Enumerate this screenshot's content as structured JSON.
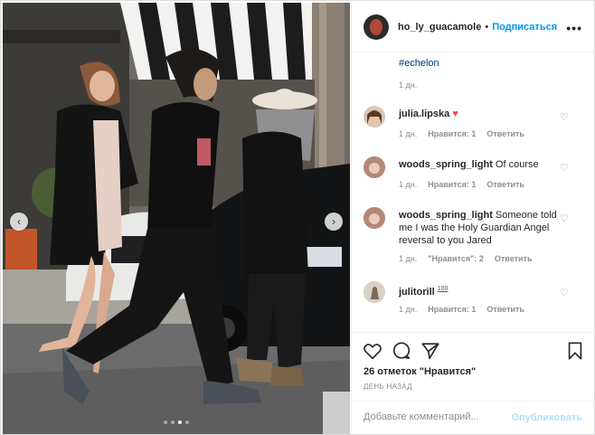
{
  "post": {
    "username": "ho_ly_guacamole",
    "separator": "•",
    "follow_label": "Подписаться",
    "more_label": "•••",
    "caption_tag": "#echelon",
    "caption_time": "1 дн.",
    "carousel": {
      "prev_icon": "chevron-left-icon",
      "next_icon": "chevron-right-icon",
      "dot_count": 4,
      "active_dot": 3
    }
  },
  "comments": [
    {
      "user": "julia.lipska",
      "text": "♥",
      "time": "1 дн.",
      "likes": "Нравится: 1",
      "reply": "Ответить"
    },
    {
      "user": "woods_spring_light",
      "text": "Of course",
      "time": "1 дн.",
      "likes": "Нравится: 1",
      "reply": "Ответить"
    },
    {
      "user": "woods_spring_light",
      "text": "Someone told me I was the Holy Guardian Angel reversal to you Jared",
      "time": "1 дн.",
      "likes": "\"Нравится\": 2",
      "reply": "Ответить"
    },
    {
      "user": "julitorill",
      "text": "100",
      "time": "1 дн.",
      "likes": "Нравится: 1",
      "reply": "Ответить"
    }
  ],
  "actions": {
    "likes_text": "26 отметок \"Нравится\"",
    "date_text": "ДЕНЬ НАЗАД"
  },
  "add_comment": {
    "placeholder": "Добавьте комментарий...",
    "publish_label": "Опубликовать"
  },
  "colors": {
    "accent": "#0095f6",
    "heart": "#ed4956",
    "muted": "#8e8e8e",
    "publish_disabled": "#b2dffc"
  }
}
